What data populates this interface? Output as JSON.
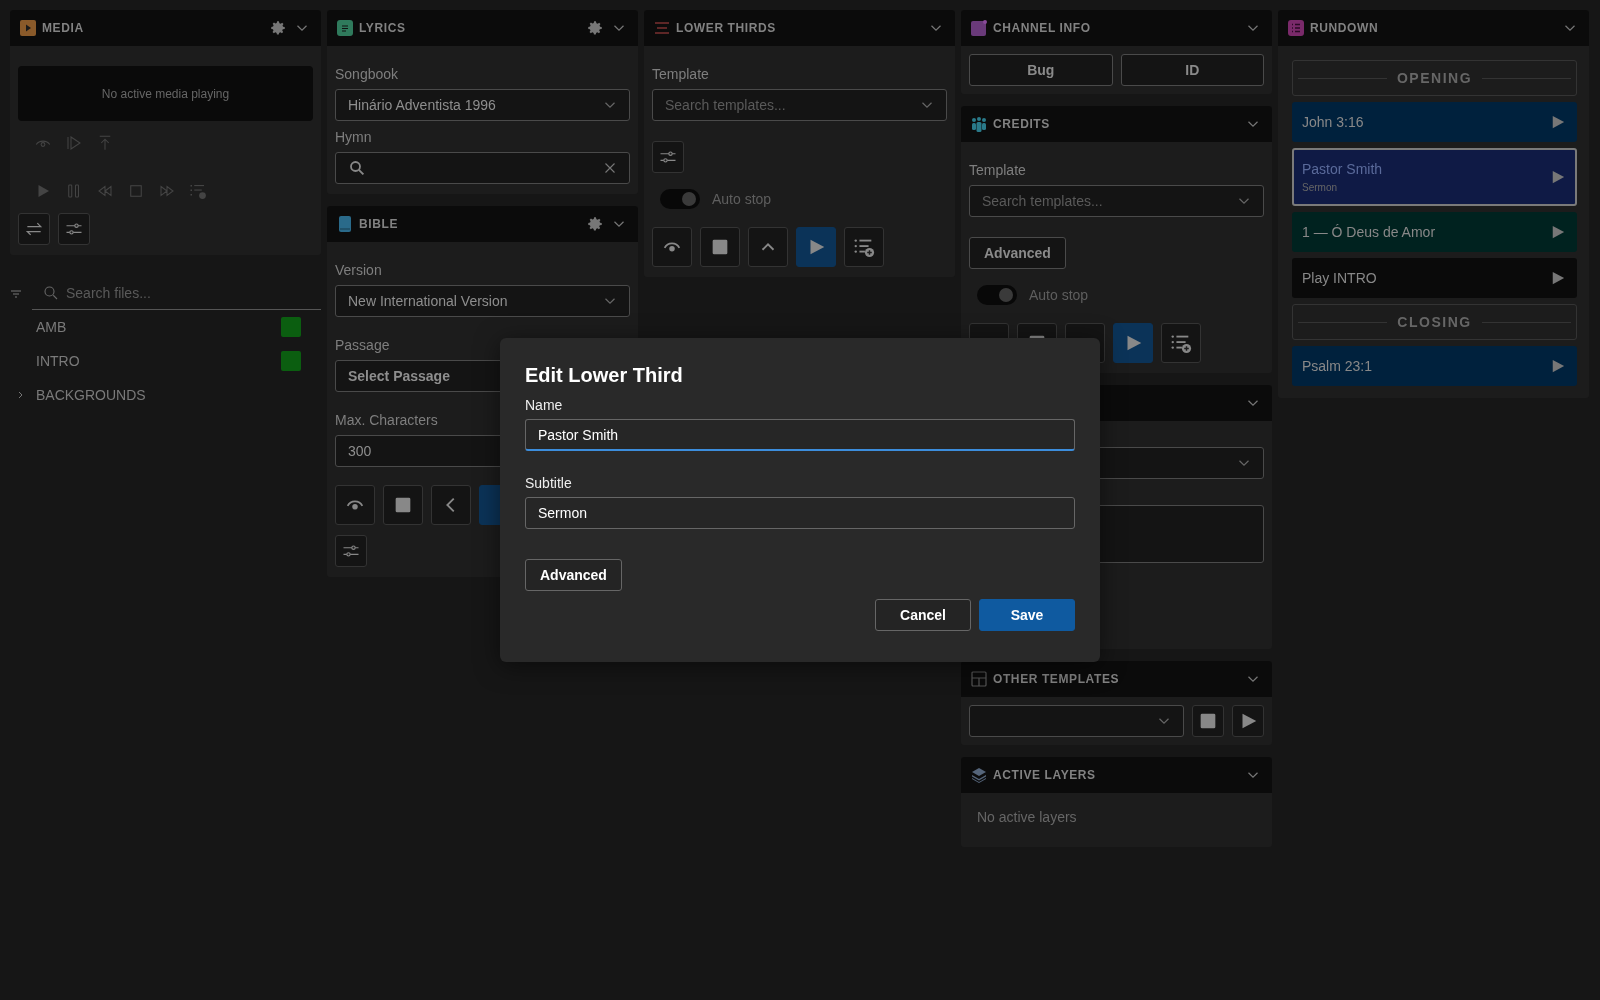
{
  "media": {
    "title": "MEDIA",
    "status": "No active media playing",
    "search": {
      "placeholder": "Search files..."
    },
    "files": [
      {
        "name": "AMB",
        "color": "#0b5e10"
      },
      {
        "name": "INTRO",
        "color": "#0b5e10"
      }
    ],
    "folders": [
      {
        "name": "BACKGROUNDS",
        "expanded": false
      }
    ]
  },
  "lyrics": {
    "title": "LYRICS",
    "songbook": {
      "label": "Songbook",
      "value": "Hinário Adventista 1996"
    },
    "hymn": {
      "label": "Hymn"
    }
  },
  "bible": {
    "title": "BIBLE",
    "version": {
      "label": "Version",
      "value": "New International Version"
    },
    "passage": {
      "label": "Passage",
      "value": "Select Passage"
    },
    "max_characters": {
      "label": "Max. Characters",
      "value": "300"
    }
  },
  "lower_thirds": {
    "title": "LOWER THIRDS",
    "template": {
      "label": "Template",
      "placeholder": "Search templates..."
    },
    "auto_stop": {
      "label": "Auto stop",
      "on": true
    }
  },
  "channel_info": {
    "title": "CHANNEL INFO",
    "buttons": [
      "Bug",
      "ID"
    ]
  },
  "credits": {
    "title": "CREDITS",
    "template": {
      "label": "Template",
      "placeholder": "Search templates..."
    },
    "advanced": "Advanced",
    "auto_stop": {
      "label": "Auto stop",
      "on": true
    }
  },
  "other_templates": {
    "title": "OTHER TEMPLATES"
  },
  "active_layers": {
    "title": "ACTIVE LAYERS",
    "empty": "No active layers"
  },
  "rundown": {
    "title": "RUNDOWN",
    "items": [
      {
        "kind": "section",
        "title": "OPENING"
      },
      {
        "kind": "entry",
        "title": "John 3:16",
        "color": "#00213d",
        "selected": false
      },
      {
        "kind": "entry",
        "title": "Pastor Smith",
        "subtitle": "Sermon",
        "color": "#0f1a45",
        "selected": true
      },
      {
        "kind": "entry",
        "title": "1 — Ó Deus de Amor",
        "color": "#00221f",
        "selected": false
      },
      {
        "kind": "entry",
        "title": "Play INTRO",
        "color": "#0a0a0a",
        "selected": false
      },
      {
        "kind": "section",
        "title": "CLOSING"
      },
      {
        "kind": "entry",
        "title": "Psalm 23:1",
        "color": "#00213d",
        "selected": false
      }
    ]
  },
  "dialog": {
    "title": "Edit Lower Third",
    "fields": [
      {
        "label": "Name",
        "value": "Pastor Smith",
        "focused": true
      },
      {
        "label": "Subtitle",
        "value": "Sermon",
        "focused": false
      }
    ],
    "advanced": "Advanced",
    "buttons": [
      {
        "label": "Cancel",
        "primary": false
      },
      {
        "label": "Save",
        "primary": true
      }
    ]
  }
}
